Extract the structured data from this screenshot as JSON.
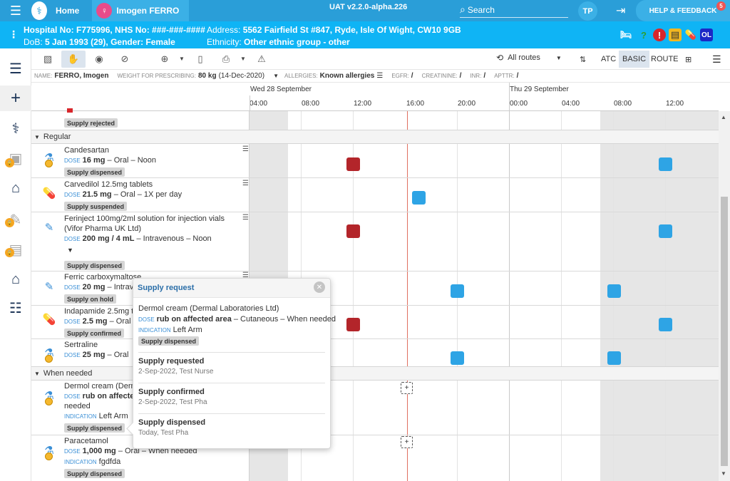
{
  "topbar": {
    "home_label": "Home",
    "patient_name": "Imogen FERRO",
    "version": "UAT v2.2.0-alpha.226",
    "search_label": "Search",
    "user_initials": "TP",
    "help_label": "HELP & FEEDBACK",
    "help_count": "5"
  },
  "banner": {
    "hospital_no": "Hospital No: F775996, NHS No: ###-###-####",
    "address_label": "Address:",
    "address": "5562 Fairfield St #847, Ryde, Isle Of Wight, CW10 9GB",
    "dob_label": "DoB:",
    "dob": "5 Jan 1993 (29), Gender: Female",
    "ethnicity_label": "Ethnicity:",
    "ethnicity": "Other ethnic group - other",
    "icon_ol": "OL"
  },
  "toolbar": {
    "routes_label": "All routes",
    "atc": "ATC",
    "basic": "BASIC",
    "route": "ROUTE"
  },
  "summary": {
    "name_k": "Name:",
    "name_v": "FERRO, Imogen",
    "weight_k": "Weight for prescribing:",
    "weight_v": "80 kg",
    "weight_date": "(14-Dec-2020)",
    "allergies_k": "Allergies:",
    "allergies_v": "Known allergies",
    "egfr_k": "eGFR:",
    "egfr_v": "/",
    "creat_k": "Creatinine:",
    "creat_v": "/",
    "inr_k": "INR:",
    "inr_v": "/",
    "apttr_k": "APTTR:",
    "apttr_v": "/"
  },
  "timeline": {
    "day1": "Wed 28 September",
    "day2": "Thu 29 September",
    "hours": [
      "04:00",
      "08:00",
      "12:00",
      "16:00",
      "20:00",
      "00:00",
      "04:00",
      "08:00",
      "12:00"
    ]
  },
  "groups": {
    "regular": "Regular",
    "when_needed": "When needed"
  },
  "top_row": {
    "badge": "Supply rejected"
  },
  "meds": [
    {
      "name": "Candesartan",
      "dose_k": "DOSE",
      "dose": "16 mg",
      "rest": " – Oral – Noon",
      "badge": "Supply dispensed"
    },
    {
      "name": "Carvedilol 12.5mg tablets",
      "dose_k": "DOSE",
      "dose": "21.5 mg",
      "rest": " – Oral – 1X per day",
      "badge": "Supply suspended"
    },
    {
      "name": "Ferinject 100mg/2ml solution for injection vials",
      "name2": "(Vifor Pharma UK Ltd)",
      "dose_k": "DOSE",
      "dose": "200 mg / 4 mL",
      "rest": " – Intravenous – Noon",
      "badge": "Supply dispensed"
    },
    {
      "name": "Ferric carboxymaltose",
      "dose_k": "DOSE",
      "dose": "20 mg",
      "rest": " – Intrave",
      "badge": "Supply on hold"
    },
    {
      "name": "Indapamide 2.5mg ta",
      "dose_k": "DOSE",
      "dose": "2.5 mg",
      "rest": " – Oral",
      "badge": "Supply confirmed"
    },
    {
      "name": "Sertraline",
      "dose_k": "DOSE",
      "dose": "25 mg",
      "rest": " – Oral",
      "badge": ""
    },
    {
      "name": "Dermol cream (Derm",
      "dose_k": "DOSE",
      "dose": "rub on affecte",
      "rest": "",
      "extra": "needed",
      "ind_k": "INDICATION",
      "ind": "Left Arm",
      "badge": "Supply dispensed"
    },
    {
      "name": "Paracetamol",
      "dose_k": "DOSE",
      "dose": "1,000 mg",
      "rest": " – Oral – When needed",
      "ind_k": "INDICATION",
      "ind": "fgdfda",
      "badge": "Supply dispensed"
    }
  ],
  "popover": {
    "title": "Supply request",
    "med": "Dermol cream (Dermal Laboratories Ltd)",
    "dose_k": "DOSE",
    "dose": "rub on affected area",
    "dose_rest": " – Cutaneous – When needed",
    "ind_k": "INDICATION",
    "ind": "Left Arm",
    "badge": "Supply dispensed",
    "events": [
      {
        "title": "Supply requested",
        "sub": "2-Sep-2022, Test Nurse"
      },
      {
        "title": "Supply confirmed",
        "sub": "2-Sep-2022, Test Pha"
      },
      {
        "title": "Supply dispensed",
        "sub": "Today, Test Pha"
      }
    ]
  },
  "icons": {
    "menu": "hamburger-icon",
    "close": "close-icon"
  }
}
